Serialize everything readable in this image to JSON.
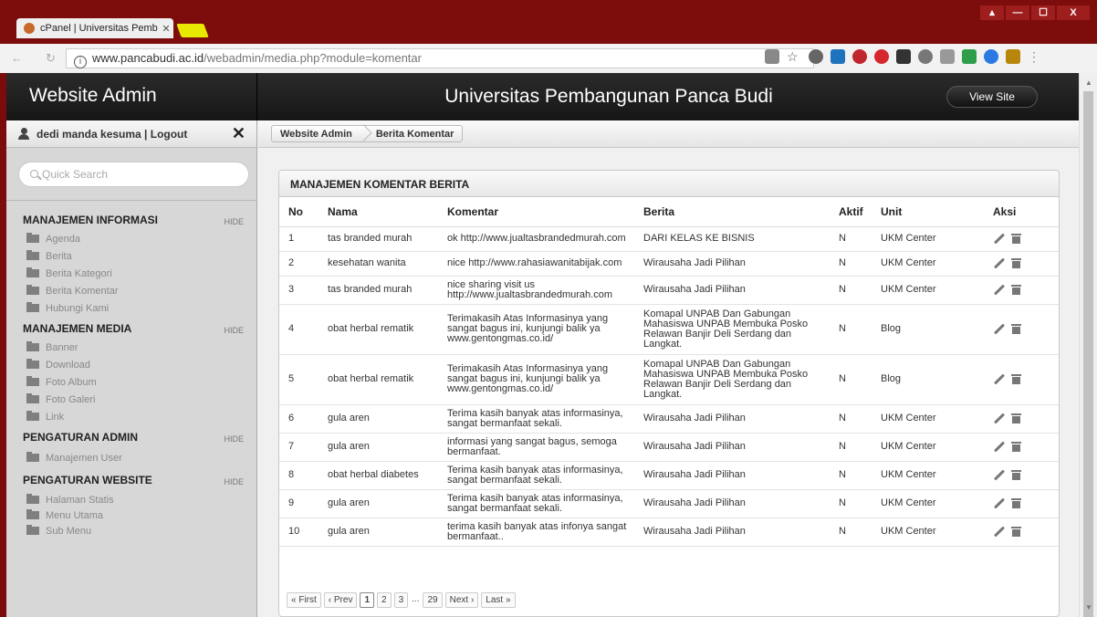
{
  "browser": {
    "tab_title": "cPanel | Universitas Pemb",
    "tab_close": "✕",
    "url_host": "www.pancabudi.ac.id",
    "url_path": "/webadmin/media.php?module=komentar",
    "window_buttons": [
      "▴",
      "—",
      "☐",
      "X"
    ]
  },
  "header": {
    "brand": "Website Admin",
    "site_title": "Universitas Pembangunan Panca Budi",
    "view_site": "View Site"
  },
  "sidebar": {
    "user": "dedi manda kesuma | Logout",
    "close": "✕",
    "search_placeholder": "Quick Search",
    "sections": [
      {
        "title": "MANAJEMEN INFORMASI",
        "hide": "HIDE",
        "items": [
          "Agenda",
          "Berita",
          "Berita Kategori",
          "Berita Komentar",
          "Hubungi Kami"
        ]
      },
      {
        "title": "MANAJEMEN MEDIA",
        "hide": "HIDE",
        "items": [
          "Banner",
          "Download",
          "Foto Album",
          "Foto Galeri",
          "Link"
        ]
      },
      {
        "title": "PENGATURAN ADMIN",
        "hide": "HIDE",
        "items": [
          "Manajemen User"
        ]
      },
      {
        "title": "PENGATURAN WEBSITE",
        "hide": "HIDE",
        "items": [
          "Halaman Statis",
          "Menu Utama",
          "Sub Menu"
        ]
      }
    ]
  },
  "breadcrumb": [
    "Website Admin",
    "Berita Komentar"
  ],
  "panel": {
    "title": "MANAJEMEN KOMENTAR BERITA",
    "columns": [
      "No",
      "Nama",
      "Komentar",
      "Berita",
      "Aktif",
      "Unit",
      "Aksi"
    ],
    "rows": [
      [
        "1",
        "tas branded murah",
        "ok http://www.jualtasbrandedmurah.com",
        "DARI KELAS KE BISNIS",
        "N",
        "UKM Center"
      ],
      [
        "2",
        "kesehatan wanita",
        "nice http://www.rahasiawanitabijak.com",
        "Wirausaha Jadi Pilihan",
        "N",
        "UKM Center"
      ],
      [
        "3",
        "tas branded murah",
        "nice sharing visit us http://www.jualtasbrandedmurah.com",
        "Wirausaha Jadi Pilihan",
        "N",
        "UKM Center"
      ],
      [
        "4",
        "obat herbal rematik",
        "Terimakasih Atas Informasinya yang sangat bagus ini, kunjungi balik ya www.gentongmas.co.id/",
        "Komapal UNPAB Dan Gabungan Mahasiswa UNPAB Membuka Posko Relawan Banjir Deli Serdang dan Langkat.",
        "N",
        "Blog"
      ],
      [
        "5",
        "obat herbal rematik",
        "Terimakasih Atas Informasinya yang sangat bagus ini, kunjungi balik ya www.gentongmas.co.id/",
        "Komapal UNPAB Dan Gabungan Mahasiswa UNPAB Membuka Posko Relawan Banjir Deli Serdang dan Langkat.",
        "N",
        "Blog"
      ],
      [
        "6",
        "gula aren",
        "Terima kasih banyak atas informasinya, sangat bermanfaat sekali.",
        "Wirausaha Jadi Pilihan",
        "N",
        "UKM Center"
      ],
      [
        "7",
        "gula aren",
        "informasi yang sangat bagus, semoga bermanfaat.",
        "Wirausaha Jadi Pilihan",
        "N",
        "UKM Center"
      ],
      [
        "8",
        "obat herbal diabetes",
        "Terima kasih banyak atas informasinya, sangat bermanfaat sekali.",
        "Wirausaha Jadi Pilihan",
        "N",
        "UKM Center"
      ],
      [
        "9",
        "gula aren",
        "Terima kasih banyak atas informasinya, sangat bermanfaat sekali.",
        "Wirausaha Jadi Pilihan",
        "N",
        "UKM Center"
      ],
      [
        "10",
        "gula aren",
        "terima kasih banyak atas infonya sangat bermanfaat..",
        "Wirausaha Jadi Pilihan",
        "N",
        "UKM Center"
      ]
    ]
  },
  "pager": [
    "« First",
    "‹ Prev",
    "1",
    "2",
    "3",
    "...",
    "29",
    "Next ›",
    "Last »"
  ],
  "pager_current": "1",
  "colors": {
    "chrome": "#7d0d0d",
    "topbar": "#1f1f1f",
    "sidebar": "#d7d7d7"
  }
}
